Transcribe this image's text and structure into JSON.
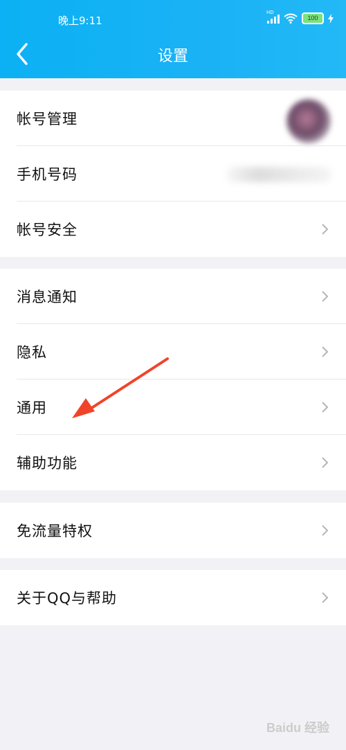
{
  "status_bar": {
    "time": "晚上9:11",
    "signal_label": "HD",
    "battery": "100"
  },
  "header": {
    "title": "设置"
  },
  "groups": [
    {
      "items": [
        {
          "label": "帐号管理"
        },
        {
          "label": "手机号码"
        },
        {
          "label": "帐号安全"
        }
      ]
    },
    {
      "items": [
        {
          "label": "消息通知"
        },
        {
          "label": "隐私"
        },
        {
          "label": "通用"
        },
        {
          "label": "辅助功能"
        }
      ]
    },
    {
      "items": [
        {
          "label": "免流量特权"
        }
      ]
    },
    {
      "items": [
        {
          "label": "关于QQ与帮助"
        }
      ]
    }
  ],
  "annotation": {
    "color": "#f0442a",
    "points_to": "通用"
  },
  "watermark": "Baidu 经验",
  "colors": {
    "header": "#12b3f5",
    "background": "#f2f2f6"
  }
}
